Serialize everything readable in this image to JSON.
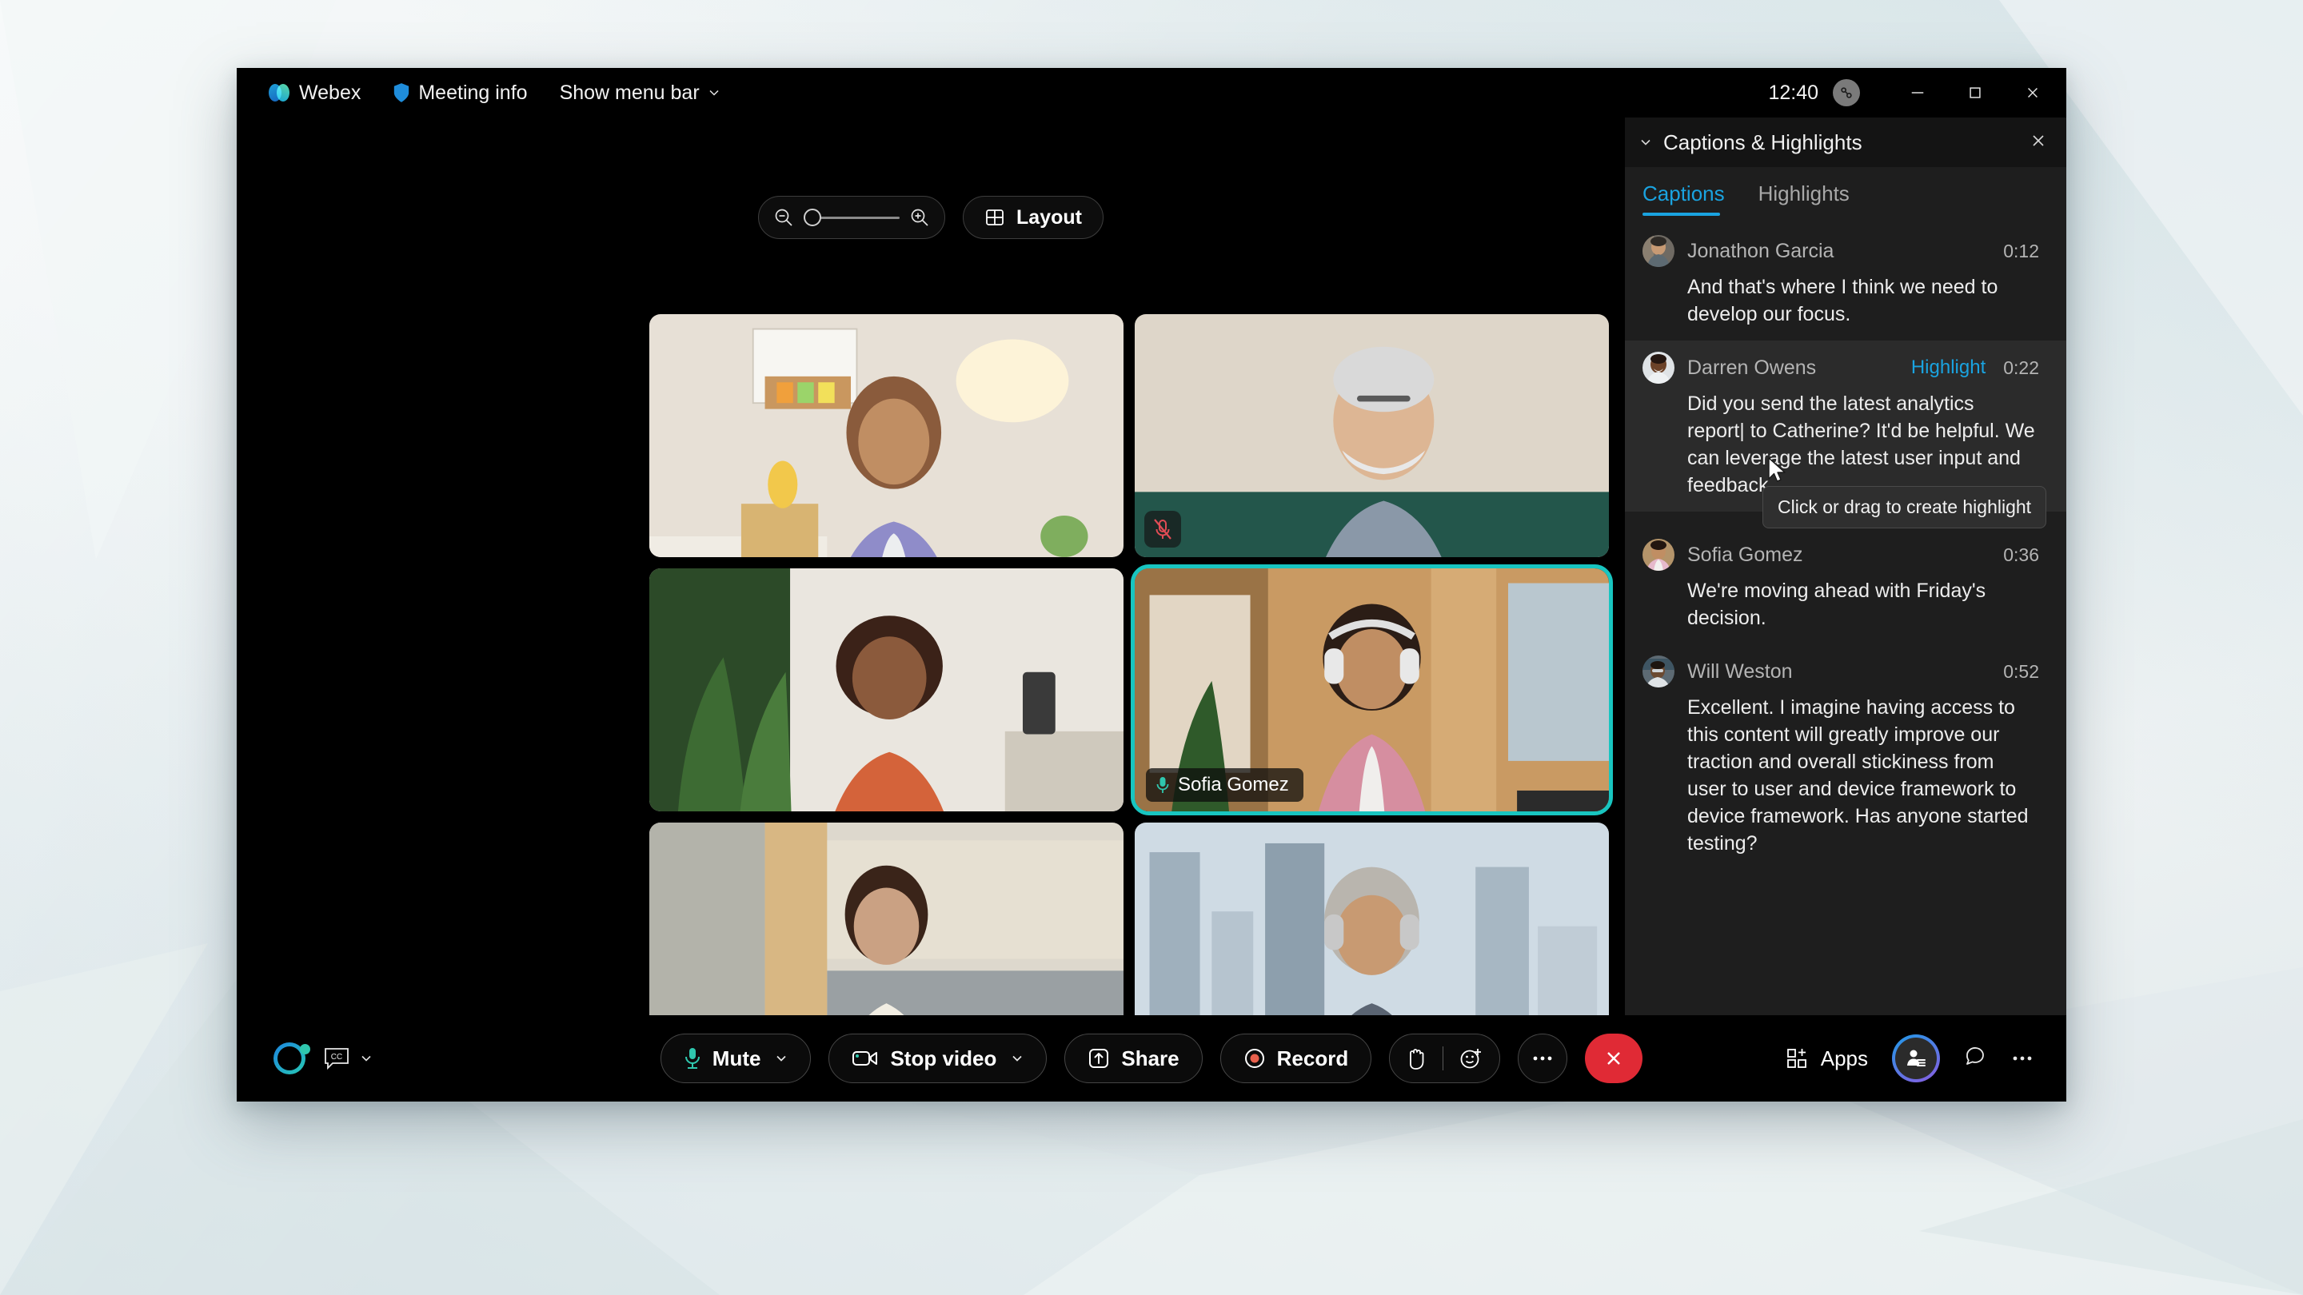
{
  "window": {
    "titlebar": {
      "app_name": "Webex",
      "meeting_info_label": "Meeting info",
      "menu_bar_label": "Show menu bar",
      "clock": "12:40",
      "link_icon": "connection-icon",
      "minimize_icon": "minimize-icon",
      "maximize_icon": "maximize-icon",
      "close_icon": "close-icon"
    }
  },
  "stage": {
    "zoom": {
      "zoom_out_icon": "zoom-out-icon",
      "zoom_in_icon": "zoom-in-icon",
      "slider_position_percent": 0
    },
    "layout_button": {
      "label": "Layout",
      "icon": "grid-layout-icon"
    },
    "tiles": [
      {
        "name": "",
        "muted": false,
        "active": false,
        "label_visible": false
      },
      {
        "name": "",
        "muted": true,
        "active": false,
        "label_visible": false
      },
      {
        "name": "",
        "muted": false,
        "active": false,
        "label_visible": false
      },
      {
        "name": "Sofia Gomez",
        "muted": false,
        "active": true,
        "label_visible": true
      },
      {
        "name": "",
        "muted": true,
        "active": false,
        "label_visible": false
      },
      {
        "name": "",
        "muted": false,
        "active": false,
        "label_visible": false
      }
    ]
  },
  "controlbar": {
    "assistant_icon": "webex-assistant-icon",
    "captions_icon": "closed-captions-icon",
    "captions_chevron_icon": "chevron-down-icon",
    "mute": {
      "label": "Mute",
      "icon": "microphone-icon"
    },
    "video": {
      "label": "Stop video",
      "icon": "camera-icon"
    },
    "share": {
      "label": "Share",
      "icon": "share-screen-icon"
    },
    "record": {
      "label": "Record",
      "icon": "record-icon"
    },
    "reactions": {
      "hand_icon": "raise-hand-icon",
      "emoji_icon": "add-reaction-icon"
    },
    "more_icon": "more-options-icon",
    "leave_icon": "leave-meeting-icon",
    "apps": {
      "label": "Apps",
      "icon": "apps-grid-icon"
    },
    "participants_icon": "participants-icon",
    "chat_icon": "chat-bubble-icon",
    "right_more_icon": "more-options-icon"
  },
  "panel": {
    "collapse_icon": "chevron-down-icon",
    "title": "Captions & Highlights",
    "close_icon": "close-icon",
    "tabs": [
      {
        "label": "Captions",
        "active": true
      },
      {
        "label": "Highlights",
        "active": false
      }
    ],
    "captions": [
      {
        "speaker": "Jonathon Garcia",
        "time": "0:12",
        "text": "And that's where I think we need to develop our focus.",
        "highlight_label": "",
        "hovered": false
      },
      {
        "speaker": "Darren Owens",
        "time": "0:22",
        "text": "Did you send the latest analytics report| to Catherine? It'd be helpful. We can leverage the latest user input and feedback",
        "highlight_label": "Highlight",
        "hovered": true
      },
      {
        "speaker": "Sofia Gomez",
        "time": "0:36",
        "text": "We're moving ahead with Friday's decision.",
        "highlight_label": "",
        "hovered": false
      },
      {
        "speaker": "Will Weston",
        "time": "0:52",
        "text": "Excellent. I imagine having access to this content will greatly improve our traction and overall stickiness from user to user and device framework to device framework. Has anyone started testing?",
        "highlight_label": "",
        "hovered": false
      }
    ],
    "tooltip": {
      "text": "Click or drag to create highlight"
    }
  },
  "colors": {
    "accent_blue": "#1aa3e0",
    "active_speaker_teal": "#18c5c0",
    "mic_green": "#2fc7ae",
    "record_red": "#e8604c",
    "leave_red": "#e02a35",
    "mute_red": "#e04c55"
  }
}
